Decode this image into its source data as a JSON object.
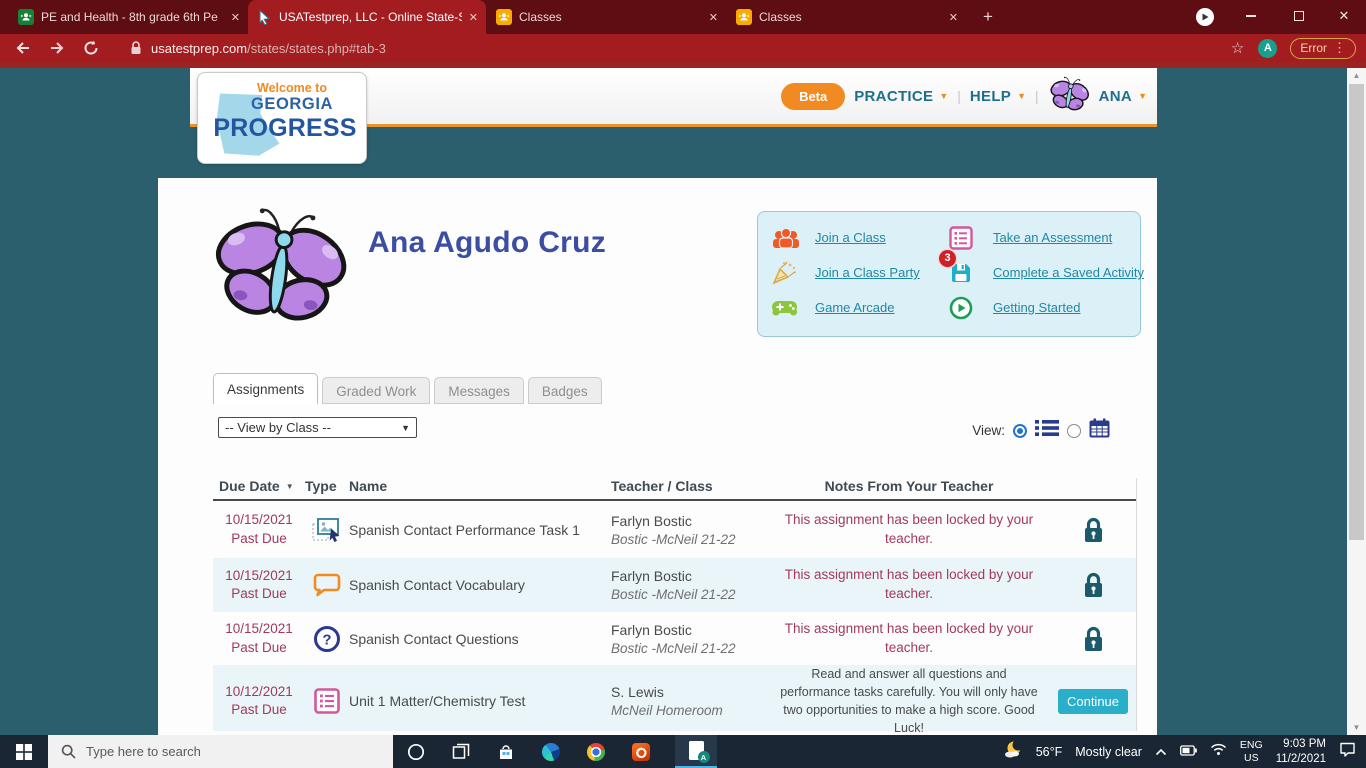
{
  "glyphs": {
    "close": "✕",
    "new_tab": "+",
    "kebab": "⋮",
    "star": "☆",
    "caret": "▼",
    "pipe": "|",
    "sort": "▼",
    "up_arrow": "▲",
    "down_arrow": "▼",
    "question": "?"
  },
  "colors": {
    "chrome_frame": "#5E0E12",
    "chrome_toolbar": "#A31D20",
    "page_top_strip": "#9B2423",
    "page_background": "#2B5F6D",
    "accent_orange": "#E9942E",
    "beta_orange": "#F08A21",
    "link_teal": "#2187A5",
    "student_name_blue": "#3B4EA1",
    "past_due_raspberry": "#A23A59",
    "lock_teal": "#1A5A6A",
    "continue_teal": "#2BAEC9",
    "row_alt_blue": "#E9F5F9",
    "taskbar_navy": "#1A2633"
  },
  "browser": {
    "tabs": [
      {
        "title": "PE and Health - 8th grade 6th Pe"
      },
      {
        "title": "USATestprep, LLC - Online State-S"
      },
      {
        "title": "Classes"
      },
      {
        "title": "Classes"
      }
    ],
    "url_domain": "usatestprep.com",
    "url_path": "/states/states.php#tab-3",
    "avatar_initial": "A",
    "error_label": "Error"
  },
  "site": {
    "logo": {
      "welcome": "Welcome to",
      "state": "GEORGIA",
      "name": "PROGRESS"
    },
    "nav": {
      "beta": "Beta",
      "practice": "PRACTICE",
      "help": "HELP",
      "user": "ANA"
    },
    "student_name": "Ana Agudo Cruz",
    "quick_links": [
      {
        "label": "Join a Class"
      },
      {
        "label": "Take an Assessment"
      },
      {
        "label": "Join a Class Party"
      },
      {
        "label": "Complete a Saved Activity",
        "badge": "3"
      },
      {
        "label": "Game Arcade"
      },
      {
        "label": "Getting Started"
      }
    ],
    "tabs": [
      {
        "label": "Assignments"
      },
      {
        "label": "Graded Work"
      },
      {
        "label": "Messages"
      },
      {
        "label": "Badges"
      }
    ],
    "filter_value": "-- View by Class --",
    "view_label": "View:",
    "table": {
      "headers": [
        "Due Date",
        "Type",
        "Name",
        "Teacher / Class",
        "Notes From Your Teacher"
      ],
      "rows": [
        {
          "date": "10/15/2021",
          "status": "Past Due",
          "name": "Spanish Contact Performance Task 1",
          "teacher": "Farlyn Bostic",
          "class": "Bostic -McNeil 21-22",
          "note": "This assignment has been locked by your teacher."
        },
        {
          "date": "10/15/2021",
          "status": "Past Due",
          "name": "Spanish Contact Vocabulary",
          "teacher": "Farlyn Bostic",
          "class": "Bostic -McNeil 21-22",
          "note": "This assignment has been locked by your teacher."
        },
        {
          "date": "10/15/2021",
          "status": "Past Due",
          "name": "Spanish Contact Questions",
          "teacher": "Farlyn Bostic",
          "class": "Bostic -McNeil 21-22",
          "note": "This assignment has been locked by your teacher."
        },
        {
          "date": "10/12/2021",
          "status": "Past Due",
          "name": "Unit 1 Matter/Chemistry Test",
          "teacher": "S. Lewis",
          "class": "McNeil Homeroom",
          "note": "Read and answer all questions and performance tasks carefully. You will only have two opportunities to make a high score. Good Luck!",
          "action": "Continue"
        }
      ]
    }
  },
  "taskbar": {
    "search_placeholder": "Type here to search",
    "weather_temp": "56°F",
    "weather_desc": "Mostly clear",
    "lang_line1": "ENG",
    "lang_line2": "US",
    "time": "9:03 PM",
    "date": "11/2/2021"
  }
}
